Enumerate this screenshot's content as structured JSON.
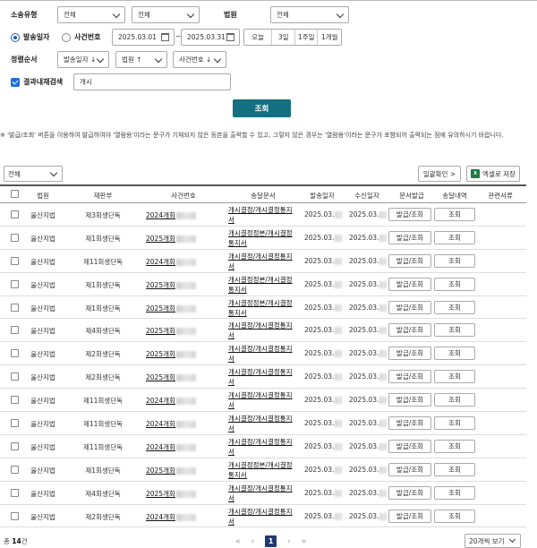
{
  "search": {
    "case_type_label": "소송유형",
    "case_type_value1": "전체",
    "case_type_value2": "전체",
    "court_label": "법원",
    "court_value": "전체",
    "radio_date_label": "발송일자",
    "radio_case_label": "사건번호",
    "date_from": "2025.03.01",
    "date_sep": "~",
    "date_to": "2025.03.31",
    "quick_ranges": [
      "오늘",
      "3일",
      "1주일",
      "1개월"
    ],
    "sort_label": "정렬순서",
    "sort_options": [
      "발송일자 ↓",
      "법원 ↑",
      "사건번호 ↓"
    ],
    "result_search_label": "결과내재검색",
    "result_search_value": "개시",
    "search_button": "조회",
    "notice": "※ '발급/조회' 버튼을 이용하여 발급하여야 '열람용'이라는 문구가 기재되지 않은 등본을 출력할 수 있고, 그렇지 않은 경우는 '열람용'이라는 문구가 포함되어 출력되는 점에 유의하시기 바랍니다."
  },
  "list": {
    "filter_value": "전체",
    "bulk_check_button": "일괄확인 >",
    "excel_button": "엑셀로 저장",
    "excel_icon_text": "X",
    "columns": [
      "법원",
      "재판부",
      "사건번호",
      "송달문서",
      "발송일자",
      "수신일자",
      "문서발급",
      "송달내역",
      "관련서류"
    ],
    "issue_button": "발급/조회",
    "view_button": "조회",
    "rows": [
      {
        "court": "울산지법",
        "division": "제3회생단독",
        "case": "2024개회",
        "doc": "개시결정/개시결정통지서",
        "sent": "2025.03.",
        "recv": "2025.03."
      },
      {
        "court": "울산지법",
        "division": "제1회생단독",
        "case": "2025개회",
        "doc": "개시결정정본/개시결정통지서",
        "sent": "2025.03.",
        "recv": "2025.03."
      },
      {
        "court": "울산지법",
        "division": "제11회생단독",
        "case": "2024개회",
        "doc": "개시결정/개시결정통지서",
        "sent": "2025.03.",
        "recv": "2025.03."
      },
      {
        "court": "울산지법",
        "division": "제1회생단독",
        "case": "2025개회",
        "doc": "개시결정정본/개시결정통지서",
        "sent": "2025.03.",
        "recv": "2025.03."
      },
      {
        "court": "울산지법",
        "division": "제1회생단독",
        "case": "2025개회",
        "doc": "개시결정정본/개시결정통지서",
        "sent": "2025.03.",
        "recv": "2025.03."
      },
      {
        "court": "울산지법",
        "division": "제4회생단독",
        "case": "2025개회",
        "doc": "개시결정/개시결정통지서",
        "sent": "2025.03.",
        "recv": "2025.03."
      },
      {
        "court": "울산지법",
        "division": "제2회생단독",
        "case": "2025개회",
        "doc": "개시결정/개시결정통지서",
        "sent": "2025.03.",
        "recv": "2025.03."
      },
      {
        "court": "울산지법",
        "division": "제2회생단독",
        "case": "2025개회",
        "doc": "개시결정/개시결정통지서",
        "sent": "2025.03.",
        "recv": "2025.03."
      },
      {
        "court": "울산지법",
        "division": "제11회생단독",
        "case": "2024개회",
        "doc": "개시결정/개시결정통지서",
        "sent": "2025.03.",
        "recv": "2025.03."
      },
      {
        "court": "울산지법",
        "division": "제11회생단독",
        "case": "2024개회",
        "doc": "개시결정/개시결정통지서",
        "sent": "2025.03.",
        "recv": "2025.03."
      },
      {
        "court": "울산지법",
        "division": "제11회생단독",
        "case": "2024개회",
        "doc": "개시결정/개시결정통지서",
        "sent": "2025.03.",
        "recv": "2025.03."
      },
      {
        "court": "울산지법",
        "division": "제1회생단독",
        "case": "2025개회",
        "doc": "개시결정정본/개시결정통지서",
        "sent": "2025.03.",
        "recv": "2025.03."
      },
      {
        "court": "울산지법",
        "division": "제4회생단독",
        "case": "2025개회",
        "doc": "개시결정/개시결정통지서",
        "sent": "2025.03.",
        "recv": "2025.03."
      },
      {
        "court": "울산지법",
        "division": "제2회생단독",
        "case": "2024개회",
        "doc": "개시결정/개시결정통지서",
        "sent": "2025.03.",
        "recv": "2025.03."
      }
    ]
  },
  "footer": {
    "total_prefix": "총",
    "total_count": "14",
    "total_suffix": "건",
    "first": "«",
    "prev": "‹",
    "current_page": "1",
    "next": "›",
    "last": "»",
    "per_page": "20개씩 보기"
  }
}
